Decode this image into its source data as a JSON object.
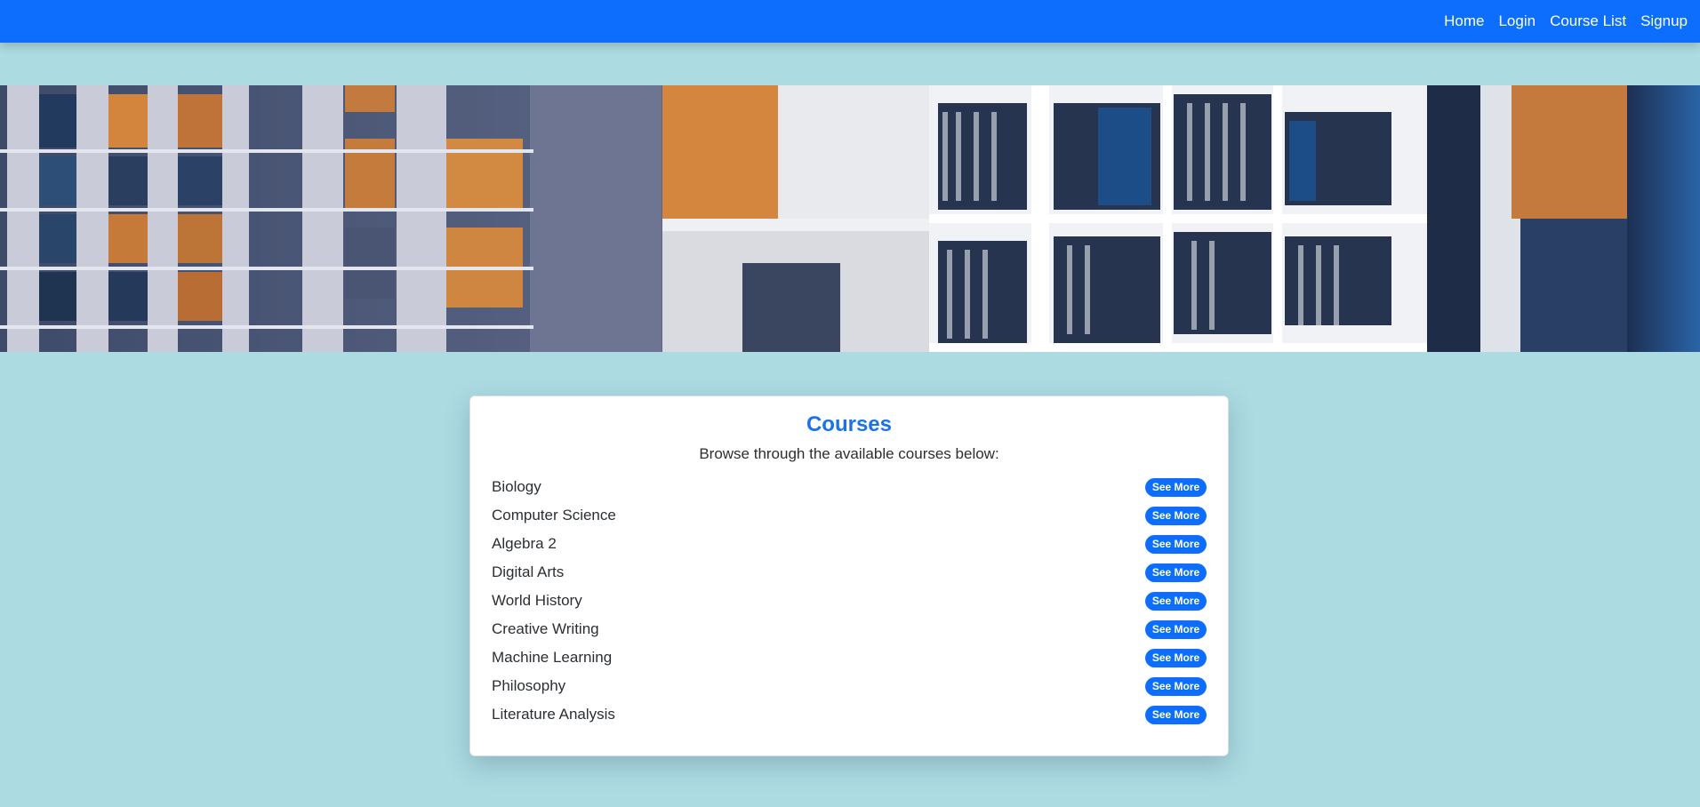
{
  "nav": {
    "links": [
      "Home",
      "Login",
      "Course List",
      "Signup"
    ]
  },
  "hero": {
    "image": "library-bookshelves-photo"
  },
  "card": {
    "title": "Courses",
    "subtitle": "Browse through the available courses below:",
    "button_label": "See More",
    "courses": [
      "Biology",
      "Computer Science",
      "Algebra 2",
      "Digital Arts",
      "World History",
      "Creative Writing",
      "Machine Learning",
      "Philosophy",
      "Literature Analysis"
    ]
  },
  "colors": {
    "navbar": "#0d6efd",
    "page_background": "#acdbe2",
    "title": "#1a73e8",
    "button": "#0d6efd"
  }
}
